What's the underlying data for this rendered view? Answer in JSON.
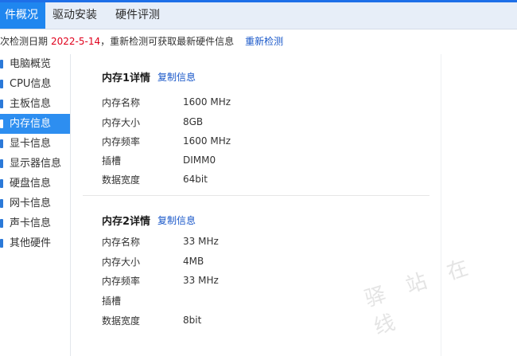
{
  "tabs": [
    {
      "label": "硬件概况",
      "shown": "件概况",
      "active": true
    },
    {
      "label": "驱动安装",
      "active": false
    },
    {
      "label": "硬件评测",
      "active": false
    }
  ],
  "infobar": {
    "prefix": "次检测日期",
    "date": "2022-5-14",
    "suffix": "，重新检测可获取最新硬件信息",
    "recheck_label": "重新检测"
  },
  "sidebar": {
    "items": [
      {
        "label": "电脑概览",
        "icon": "computer-icon"
      },
      {
        "label": "CPU信息",
        "icon": "cpu-icon"
      },
      {
        "label": "主板信息",
        "icon": "motherboard-icon"
      },
      {
        "label": "内存信息",
        "icon": "memory-icon",
        "active": true
      },
      {
        "label": "显卡信息",
        "icon": "gpu-icon"
      },
      {
        "label": "显示器信息",
        "icon": "monitor-icon"
      },
      {
        "label": "硬盘信息",
        "icon": "disk-icon"
      },
      {
        "label": "网卡信息",
        "icon": "network-card-icon"
      },
      {
        "label": "声卡信息",
        "icon": "sound-card-icon"
      },
      {
        "label": "其他硬件",
        "icon": "other-hardware-icon"
      }
    ]
  },
  "memory": [
    {
      "title": "内存1详情",
      "copy_label": "复制信息",
      "rows": [
        {
          "key": "内存名称",
          "value": "1600 MHz"
        },
        {
          "key": "内存大小",
          "value": "8GB"
        },
        {
          "key": "内存频率",
          "value": "1600 MHz"
        },
        {
          "key": "插槽",
          "value": "DIMM0"
        },
        {
          "key": "数据宽度",
          "value": "64bit"
        }
      ]
    },
    {
      "title": "内存2详情",
      "copy_label": "复制信息",
      "rows": [
        {
          "key": "内存名称",
          "value": "33 MHz"
        },
        {
          "key": "内存大小",
          "value": "4MB"
        },
        {
          "key": "内存频率",
          "value": "33 MHz"
        },
        {
          "key": "插槽",
          "value": ""
        },
        {
          "key": "数据宽度",
          "value": "8bit"
        }
      ]
    }
  ],
  "watermark": "驿 站 在 线"
}
